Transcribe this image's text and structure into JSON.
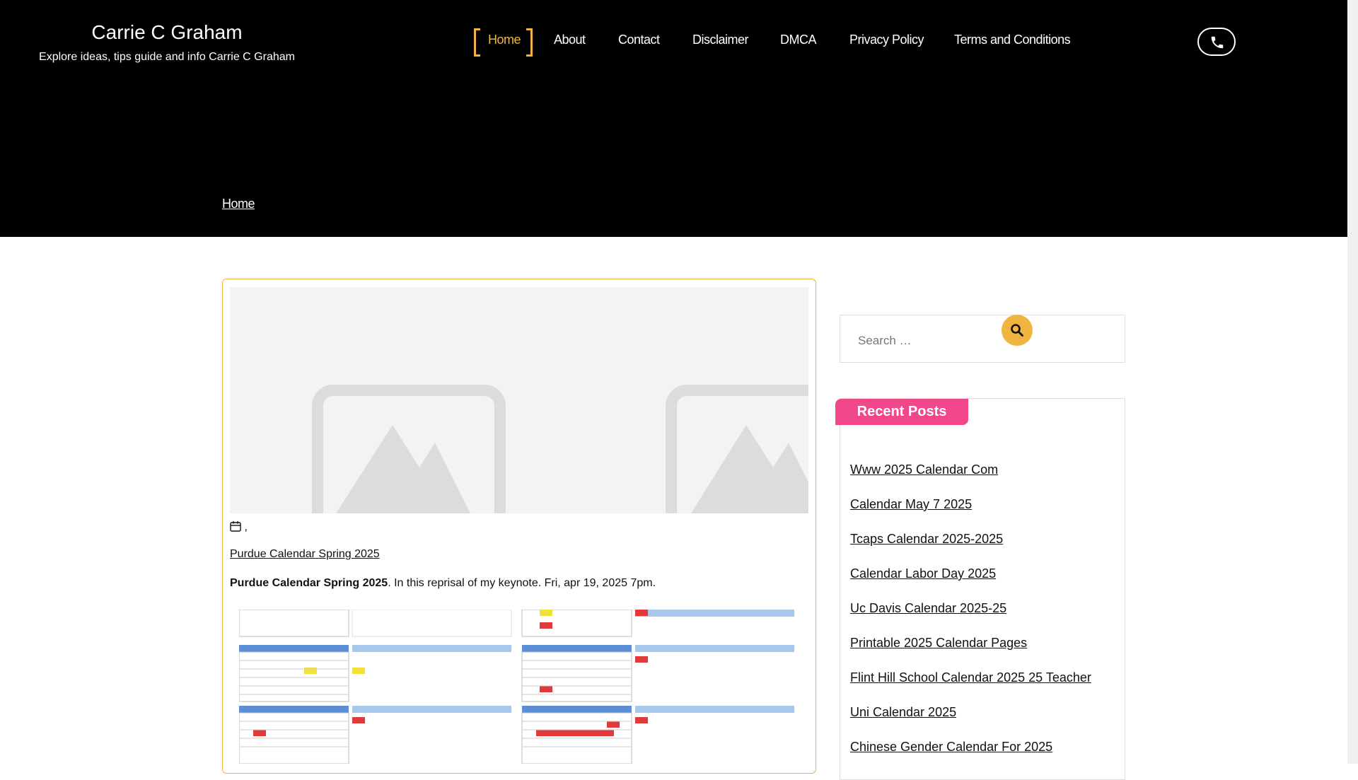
{
  "site": {
    "title": "Carrie C Graham",
    "tagline": "Explore ideas, tips guide and info Carrie C Graham"
  },
  "nav": {
    "items": [
      {
        "label": "Home",
        "active": true
      },
      {
        "label": "About"
      },
      {
        "label": "Contact"
      },
      {
        "label": "Disclaimer"
      },
      {
        "label": "DMCA"
      },
      {
        "label": "Privacy Policy"
      },
      {
        "label": "Terms and Conditions"
      }
    ]
  },
  "breadcrumb": {
    "label": "Home"
  },
  "post": {
    "meta_separator": ",",
    "title": "Purdue Calendar Spring 2025",
    "excerpt_bold": "Purdue Calendar Spring 2025",
    "excerpt_rest": ". In this reprisal of my keynote. Fri, apr 19, 2025 7pm."
  },
  "sidebar": {
    "search_placeholder": "Search …",
    "recent_heading": "Recent Posts",
    "recent_posts": [
      "Www 2025 Calendar Com",
      "Calendar May 7 2025",
      "Tcaps Calendar 2025-2025",
      "Calendar Labor Day 2025",
      "Uc Davis Calendar 2025-25",
      "Printable 2025 Calendar Pages",
      "Flint Hill School Calendar 2025 25 Teacher",
      "Uni Calendar 2025",
      "Chinese Gender Calendar For 2025"
    ]
  },
  "colors": {
    "accent": "#f0b440",
    "header_bg": "#000000",
    "recent_heading_bg": "#f0488a"
  },
  "icons": [
    "phone-icon",
    "calendar-icon",
    "search-icon",
    "image-placeholder-icon"
  ]
}
